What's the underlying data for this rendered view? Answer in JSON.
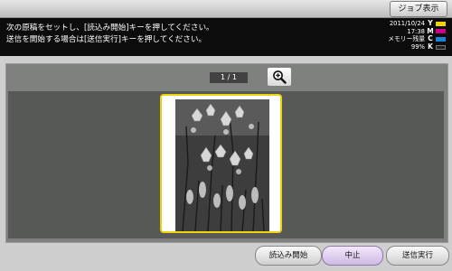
{
  "header": {
    "job_display_label": "ジョブ表示"
  },
  "message": {
    "line1": "次の原稿をセットし、[読込み開始]キーを押してください。",
    "line2": "送信を開始する場合は[送信実行]キーを押してください。"
  },
  "status": {
    "date": "2011/10/24",
    "time": "17:38",
    "memory_label": "メモリー残量",
    "memory_value": "99%"
  },
  "toner": [
    {
      "letter": "Y",
      "color": "#f2d400"
    },
    {
      "letter": "M",
      "color": "#d0008a"
    },
    {
      "letter": "C",
      "color": "#1a84d8"
    },
    {
      "letter": "K",
      "color": "#202020"
    }
  ],
  "preview": {
    "page_counter": "1 / 1",
    "zoom_icon": "zoom-in-icon"
  },
  "buttons": {
    "read_start": "読込み開始",
    "stop": "中止",
    "send": "送信実行"
  }
}
